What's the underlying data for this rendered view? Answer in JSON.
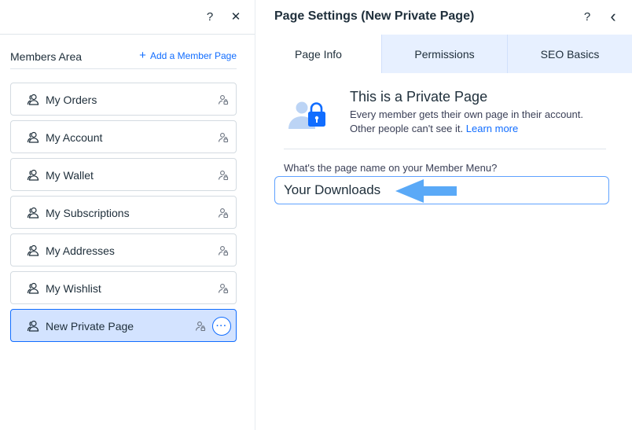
{
  "left_panel": {
    "help_label": "?",
    "close_label": "✕",
    "section_title": "Members Area",
    "add_member_plus": "+",
    "add_member_label": "Add a Member Page",
    "pages": [
      {
        "label": "My Orders"
      },
      {
        "label": "My Account"
      },
      {
        "label": "My Wallet"
      },
      {
        "label": "My Subscriptions"
      },
      {
        "label": "My Addresses"
      },
      {
        "label": "My Wishlist"
      },
      {
        "label": "New Private Page",
        "selected": true
      }
    ],
    "more_label": "···"
  },
  "right_panel": {
    "title": "Page Settings (New Private Page)",
    "help_label": "?",
    "back_label": "‹",
    "tabs": [
      {
        "label": "Page Info",
        "active": true
      },
      {
        "label": "Permissions"
      },
      {
        "label": "SEO Basics"
      }
    ],
    "private": {
      "title": "This is a Private Page",
      "description": "Every member gets their own page in their account. Other people can't see it.",
      "learn_more": "Learn more"
    },
    "name_field": {
      "label": "What's the page name on your Member Menu?",
      "value": "Your Downloads"
    }
  },
  "colors": {
    "accent": "#116dff",
    "selected_bg": "#d3e3ff",
    "tab_bg": "#e7f0ff",
    "arrow": "#5aa9f7"
  },
  "icons": {
    "member_icon": "two-person-outline-icon",
    "lock_user_icon": "person-lock-icon",
    "illustration": "private-page-lock-illustration",
    "annotation": "left-arrow-icon"
  }
}
